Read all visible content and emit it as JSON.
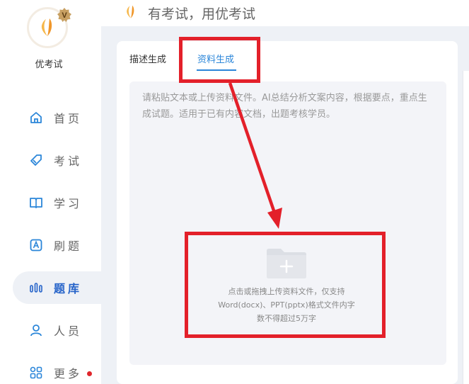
{
  "app": {
    "username": "优考试",
    "vip_badge": "V"
  },
  "header": {
    "title": "有考试，用优考试"
  },
  "sidebar": {
    "items": [
      {
        "label": "首页",
        "icon": "home-icon",
        "active": false
      },
      {
        "label": "考试",
        "icon": "tag-icon",
        "active": false
      },
      {
        "label": "学习",
        "icon": "book-icon",
        "active": false
      },
      {
        "label": "刷题",
        "icon": "letter-a-icon",
        "active": false
      },
      {
        "label": "题库",
        "icon": "bar-chart-icon",
        "active": true
      },
      {
        "label": "人员",
        "icon": "person-icon",
        "active": false
      },
      {
        "label": "更多",
        "icon": "grid-icon",
        "active": false,
        "notification": true
      }
    ]
  },
  "tabs": {
    "describe": "描述生成",
    "material": "资料生成",
    "active": "material"
  },
  "input": {
    "placeholder": "请粘贴文本或上传资料文件。AI总结分析文案内容，根据要点，重点生成试题。适用于已有内容文档，出题考核学员。"
  },
  "upload": {
    "line1": "点击或拖拽上传资料文件，仅支持",
    "line2": "Word(docx)、PPT(pptx)格式文件内字",
    "line3": "数不得超过5万字",
    "icon": "folder-plus-icon"
  },
  "colors": {
    "accent": "#2b86d9",
    "active_nav": "#2563c9",
    "annotation": "#e3202a",
    "brand_orange": "#f0a030"
  }
}
